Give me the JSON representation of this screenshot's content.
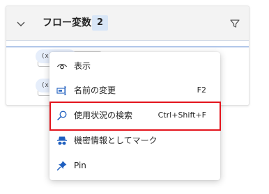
{
  "pane": {
    "title": "フロー変数",
    "count": "2",
    "var_prefix": "(x)"
  },
  "menu": {
    "items": [
      {
        "label": "表示",
        "shortcut": "",
        "icon": "eye-icon"
      },
      {
        "label": "名前の変更",
        "shortcut": "F2",
        "icon": "rename-icon"
      },
      {
        "label": "使用状況の検索",
        "shortcut": "Ctrl+Shift+F",
        "icon": "search-icon"
      },
      {
        "label": "機密情報としてマーク",
        "shortcut": "",
        "icon": "incognito-icon"
      },
      {
        "label": "Pin",
        "shortcut": "",
        "icon": "pin-icon"
      }
    ]
  },
  "colors": {
    "accent": "#2b66c4",
    "highlight": "#e3141c",
    "header_bg": "#f3f3f3",
    "badge_bg": "#d8e6f7"
  }
}
